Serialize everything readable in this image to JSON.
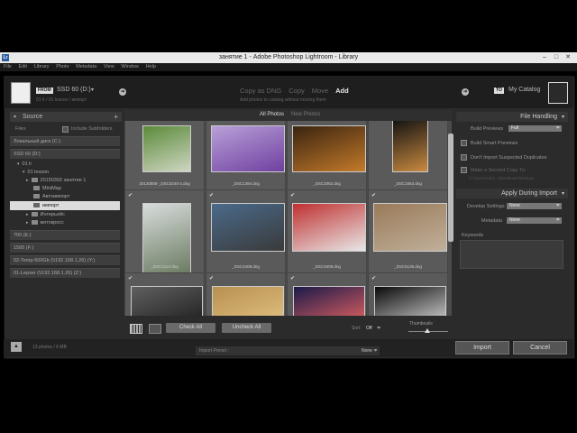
{
  "window": {
    "title": "занятие 1 - Adobe Photoshop Lightroom - Library",
    "app_icon": "Lr"
  },
  "menu": [
    "File",
    "Edit",
    "Library",
    "Photo",
    "Metadata",
    "View",
    "Window",
    "Help"
  ],
  "header": {
    "from_tag": "FROM",
    "source_name": "SSD 60 (D:)",
    "source_sub": "01 lr / 01 lesson / импорт",
    "modes": [
      "Copy as DNG",
      "Copy",
      "Move",
      "Add"
    ],
    "active_mode": "Add",
    "mode_hint": "Add photos to catalog without moving them",
    "to_tag": "TO",
    "destination": "My Catalog"
  },
  "source_panel": {
    "title": "Source",
    "files_label": "Files",
    "include_subfolders": "Include Subfolders",
    "items": [
      {
        "label": "Локальный диск (C:)",
        "kind": "volume"
      },
      {
        "label": "SSD 60 (D:)",
        "kind": "volume"
      },
      {
        "label": "01 lr",
        "kind": "folder",
        "level": 1
      },
      {
        "label": "01 lesson",
        "kind": "folder",
        "level": 2
      },
      {
        "label": "20150302 занятие 1",
        "kind": "folder",
        "level": 3
      },
      {
        "label": "MiniMap",
        "kind": "folder",
        "level": 3
      },
      {
        "label": "Автоимпорт",
        "kind": "folder",
        "level": 3
      },
      {
        "label": "импорт",
        "kind": "folder",
        "level": 3,
        "selected": true
      },
      {
        "label": "Интерьейс",
        "kind": "folder",
        "level": 3
      },
      {
        "label": "мотокросс",
        "kind": "folder",
        "level": 3
      },
      {
        "label": "700 (E:)",
        "kind": "volume"
      },
      {
        "label": "1500 (F:)",
        "kind": "volume"
      },
      {
        "label": "02-Temp-500Gb (\\\\192.168.1.26) (Y:)",
        "kind": "volume"
      },
      {
        "label": "01-Lepser (\\\\192.168.1.26) (Z:)",
        "kind": "volume"
      }
    ]
  },
  "grid": {
    "tabs": [
      "All Photos",
      "New Photos"
    ],
    "rows": [
      [
        {
          "file": "20130805-_DSC5240-2.dng",
          "colors": [
            "#5b8a3a",
            "#cfd6c2"
          ]
        },
        {
          "file": "_DSC1394.dng",
          "colors": [
            "#b8a0d8",
            "#7040a0"
          ]
        },
        {
          "file": "_DSC2062.dng",
          "colors": [
            "#3a2410",
            "#c47a2a"
          ]
        },
        {
          "file": "_DSC3463.dng",
          "colors": [
            "#111111",
            "#c98a40"
          ]
        }
      ],
      [
        {
          "file": "_DSC3113.dng",
          "colors": [
            "#d8dcdc",
            "#6a7a60"
          ]
        },
        {
          "file": "_DSC4408.dng",
          "colors": [
            "#4a6a8a",
            "#3a3a3a"
          ]
        },
        {
          "file": "_DSC4609.dng",
          "colors": [
            "#c03030",
            "#e8e8e8"
          ]
        },
        {
          "file": "_DSC5136.dng",
          "colors": [
            "#9a7a5a",
            "#c0b09a"
          ]
        }
      ],
      [
        {
          "file": "",
          "colors": [
            "#606060",
            "#202020"
          ]
        },
        {
          "file": "",
          "colors": [
            "#b89050",
            "#e0c080"
          ]
        },
        {
          "file": "",
          "colors": [
            "#1a1a4a",
            "#e06060"
          ]
        },
        {
          "file": "",
          "colors": [
            "#0a0a0a",
            "#d0d0d0"
          ]
        }
      ]
    ],
    "check_all": "Check All",
    "uncheck_all": "Uncheck All",
    "sort_label": "Sort:",
    "sort_value": "Off",
    "thumbnails_label": "Thumbnails"
  },
  "right_panel": {
    "file_handling": "File Handling",
    "build_previews_label": "Build Previews",
    "build_previews_value": "Full",
    "build_smart_previews": "Build Smart Previews",
    "dont_import_duplicates": "Don't Import Suspected Duplicates",
    "second_copy": "Make a Second Copy To:",
    "second_copy_path": "C:\\Users\\Alex\\...\\Download Backups",
    "apply_during_import": "Apply During Import",
    "develop_settings_label": "Develop Settings",
    "develop_settings_value": "None",
    "metadata_label": "Metadata",
    "metadata_value": "None",
    "keywords_label": "Keywords"
  },
  "footer": {
    "status": "13 photos / 6 MB",
    "preset_label": "Import Preset :",
    "preset_value": "None ≑",
    "import": "Import",
    "cancel": "Cancel"
  }
}
